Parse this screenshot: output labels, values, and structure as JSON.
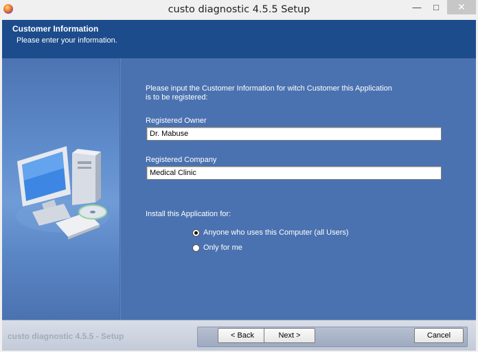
{
  "window": {
    "title": "custo diagnostic 4.5.5 Setup",
    "minimize_glyph": "—",
    "maximize_glyph": "□",
    "close_glyph": "✕"
  },
  "header": {
    "title": "Customer Information",
    "subtitle": "Please enter your information."
  },
  "form": {
    "intro_line1": "Please input the Customer Information for witch Customer this Application",
    "intro_line2": "is to be registered:",
    "owner_label": "Registered Owner",
    "owner_value": "Dr. Mabuse",
    "company_label": "Registered Company",
    "company_value": "Medical Clinic",
    "install_for_label": "Install this Application for:",
    "options": [
      {
        "label": "Anyone who uses this Computer (all Users)",
        "selected": true
      },
      {
        "label": "Only for me",
        "selected": false
      }
    ]
  },
  "footer": {
    "brand": "custo diagnostic 4.5.5 - Setup",
    "back_label": "< Back",
    "next_label": "Next >",
    "cancel_label": "Cancel"
  },
  "icons": {
    "app": "installer-icon",
    "illustration": "computer-illustration"
  },
  "colors": {
    "header_bg": "#1d4c8c",
    "body_bg": "#4b72b0"
  }
}
